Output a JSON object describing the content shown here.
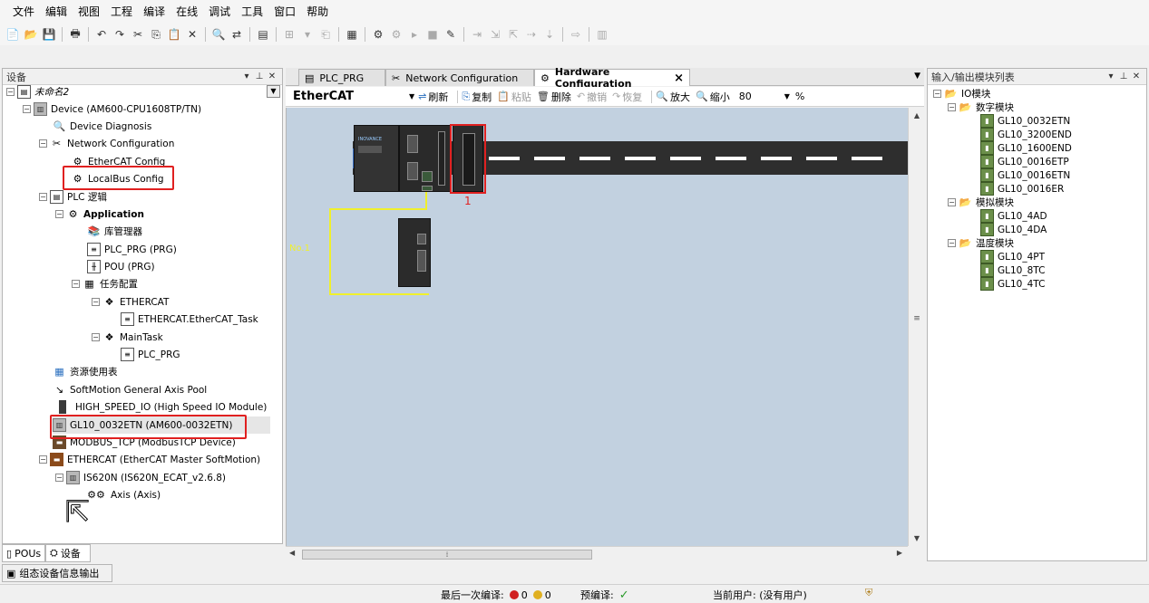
{
  "menu": [
    "文件",
    "编辑",
    "视图",
    "工程",
    "编译",
    "在线",
    "调试",
    "工具",
    "窗口",
    "帮助"
  ],
  "left_panel": {
    "title": "设备",
    "tree": [
      {
        "label": "未命名2",
        "italic": true
      },
      {
        "label": "Device (AM600-CPU1608TP/TN)"
      },
      {
        "label": "Device Diagnosis"
      },
      {
        "label": "Network Configuration"
      },
      {
        "label": "EtherCAT Config"
      },
      {
        "label": "LocalBus Config"
      },
      {
        "label": "PLC 逻辑"
      },
      {
        "label": "Application",
        "bold": true
      },
      {
        "label": "库管理器"
      },
      {
        "label": "PLC_PRG (PRG)"
      },
      {
        "label": "POU (PRG)"
      },
      {
        "label": "任务配置"
      },
      {
        "label": "ETHERCAT"
      },
      {
        "label": "ETHERCAT.EtherCAT_Task"
      },
      {
        "label": "MainTask"
      },
      {
        "label": "PLC_PRG"
      },
      {
        "label": "资源使用表"
      },
      {
        "label": "SoftMotion General Axis Pool"
      },
      {
        "label": "HIGH_SPEED_IO (High Speed IO Module)"
      },
      {
        "label": "GL10_0032ETN (AM600-0032ETN)"
      },
      {
        "label": "MODBUS_TCP (ModbusTCP Device)"
      },
      {
        "label": "ETHERCAT (EtherCAT Master SoftMotion)"
      },
      {
        "label": "IS620N (IS620N_ECAT_v2.6.8)"
      },
      {
        "label": "Axis (Axis)"
      }
    ],
    "bottom_tabs": [
      "POUs",
      "设备"
    ]
  },
  "bottom_output_tab": "组态设备信息输出",
  "editor": {
    "tabs": [
      "PLC_PRG",
      "Network Configuration",
      "Hardware Configuration"
    ],
    "bus_select": "EtherCAT",
    "buttons": {
      "refresh": "刷新",
      "copy": "复制",
      "paste": "粘贴",
      "delete": "删除",
      "undo": "撤销",
      "redo": "恢复",
      "zoom_in": "放大",
      "zoom_out": "缩小"
    },
    "zoom": "80",
    "zoom_unit": "%",
    "slot_number": "1",
    "slave_label": "No.1",
    "cpu_brand": "INOVANCE"
  },
  "right_panel": {
    "title": "输入/输出模块列表",
    "tree": [
      {
        "label": "IO模块"
      },
      {
        "label": "数字模块"
      },
      {
        "label": "GL10_0032ETN"
      },
      {
        "label": "GL10_3200END"
      },
      {
        "label": "GL10_1600END"
      },
      {
        "label": "GL10_0016ETP"
      },
      {
        "label": "GL10_0016ETN"
      },
      {
        "label": "GL10_0016ER"
      },
      {
        "label": "模拟模块"
      },
      {
        "label": "GL10_4AD"
      },
      {
        "label": "GL10_4DA"
      },
      {
        "label": "温度模块"
      },
      {
        "label": "GL10_4PT"
      },
      {
        "label": "GL10_8TC"
      },
      {
        "label": "GL10_4TC"
      }
    ]
  },
  "status": {
    "last_compile_label": "最后一次编译:",
    "errors": "0",
    "warnings": "0",
    "precompile_label": "预编译:",
    "user_label": "当前用户: (没有用户)"
  },
  "colors": {
    "highlight_box": "#e02020",
    "canvas_bg": "#c2d1e0",
    "ethercat_line": "#f0f02c"
  }
}
